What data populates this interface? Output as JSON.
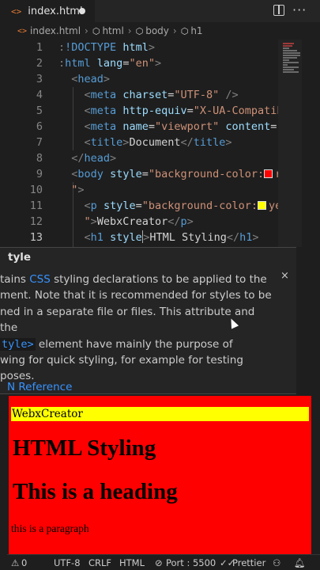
{
  "tab": {
    "icon": "<>",
    "filename": "index.html"
  },
  "breadcrumb": {
    "file": "index.html",
    "items": [
      "html",
      "body",
      "h1"
    ]
  },
  "editor": {
    "lines": [
      {
        "num": "1",
        "html": "<span class=\"p\">:</span><span class=\"t\">!DOCTYPE</span> <span class=\"a\">html</span><span class=\"p\">&gt;</span>"
      },
      {
        "num": "2",
        "html": "<span class=\"p\">:</span><span class=\"t\">html</span> <span class=\"a\">lang</span><span class=\"x\">=</span><span class=\"s\">\"en\"</span><span class=\"p\">&gt;</span>"
      },
      {
        "num": "3",
        "html": "  <span class=\"p\">&lt;</span><span class=\"t\">head</span><span class=\"p\">&gt;</span>"
      },
      {
        "num": "4",
        "html": "    <span class=\"p\">&lt;</span><span class=\"t\">meta</span> <span class=\"a\">charset</span><span class=\"x\">=</span><span class=\"s\">\"UTF-8\"</span> <span class=\"p\">/&gt;</span>"
      },
      {
        "num": "5",
        "html": "    <span class=\"p\">&lt;</span><span class=\"t\">meta</span> <span class=\"a\">http-equiv</span><span class=\"x\">=</span><span class=\"s\">\"X-UA-Compatib</span>"
      },
      {
        "num": "6",
        "html": "    <span class=\"p\">&lt;</span><span class=\"t\">meta</span> <span class=\"a\">name</span><span class=\"x\">=</span><span class=\"s\">\"viewport\"</span> <span class=\"a\">content</span><span class=\"x\">=</span><span class=\"s\">\"</span>"
      },
      {
        "num": "7",
        "html": "    <span class=\"p\">&lt;</span><span class=\"t\">title</span><span class=\"p\">&gt;</span><span class=\"x\">Document</span><span class=\"p\">&lt;/</span><span class=\"t\">title</span><span class=\"p\">&gt;</span>"
      },
      {
        "num": "8",
        "html": "  <span class=\"p\">&lt;/</span><span class=\"t\">head</span><span class=\"p\">&gt;</span>"
      },
      {
        "num": "9",
        "html": "  <span class=\"p\">&lt;</span><span class=\"t\">body</span> <span class=\"a\">style</span><span class=\"x\">=</span><span class=\"s\">\"background-color:</span><span class=\"sw\" style=\"background:#ff0000\"></span><span class=\"s\">r</span>"
      },
      {
        "num": "10",
        "html": "  <span class=\"s\">\"</span><span class=\"p\">&gt;</span>"
      },
      {
        "num": "11",
        "html": "    <span class=\"p\">&lt;</span><span class=\"t\">p</span> <span class=\"a\">style</span><span class=\"x\">=</span><span class=\"s\">\"background-color:</span><span class=\"sw\" style=\"background:#ffff00\"></span><span class=\"s\">ye</span>"
      },
      {
        "num": "12",
        "html": "    <span class=\"s\">\"</span><span class=\"p\">&gt;</span><span class=\"x\">WebxCreator</span><span class=\"p\">&lt;/</span><span class=\"t\">p</span><span class=\"p\">&gt;</span>"
      },
      {
        "num": "13",
        "html": "    <span class=\"p\">&lt;</span><span class=\"t\">h1</span> <span class=\"a\">style</span><span class=\"cursor\"></span><span class=\"p\">&gt;</span><span class=\"x\">HTML Styling</span><span class=\"p\">&lt;/</span><span class=\"t\">h1</span><span class=\"p\">&gt;</span>"
      }
    ]
  },
  "hover": {
    "title": "tyle",
    "line1_css": "CSS",
    "line1_pre": "tains ",
    "line1_post": " styling declarations to be applied to the",
    "line2": "ment. Note that it is recommended for styles to be",
    "line3": "ned in a separate file or files. This attribute and the",
    "line4_code": "tyle>",
    "line4_post": " element have mainly the purpose of",
    "line5": "wing for quick styling, for example for testing",
    "line6": "poses.",
    "reference": "N Reference",
    "close": "×"
  },
  "preview": {
    "paragraph": "WebxCreator",
    "heading1": "HTML Styling",
    "heading2": "This is a heading",
    "para2": "this is a paragraph",
    "body_bg": "#ff0000",
    "p_bg": "#ffff00"
  },
  "status": {
    "errors": "0",
    "encoding": "UTF-8",
    "eol": "CRLF",
    "language": "HTML",
    "port": "Port : 5500",
    "formatter": "Prettier"
  }
}
